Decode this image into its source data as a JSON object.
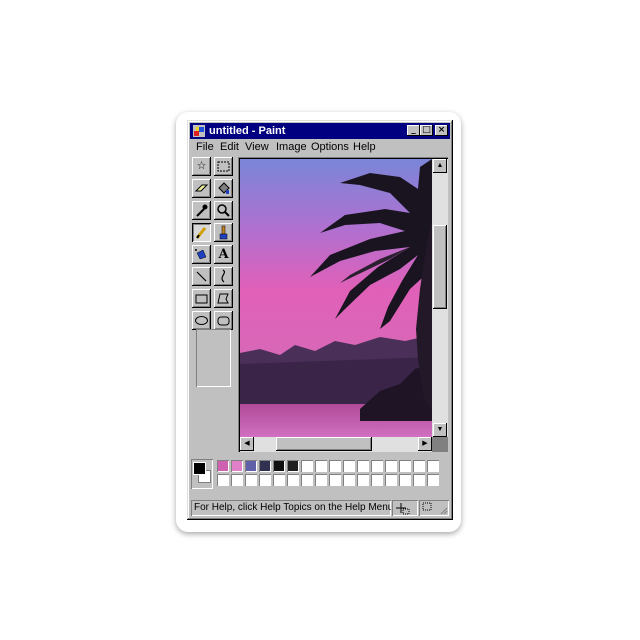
{
  "window": {
    "title": "untitled - Paint"
  },
  "title_buttons": {
    "minimize": "_",
    "maximize": "□",
    "close": "×"
  },
  "menu": [
    {
      "label": "File"
    },
    {
      "label": "Edit"
    },
    {
      "label": "View"
    },
    {
      "label": "Image"
    },
    {
      "label": "Options"
    },
    {
      "label": "Help"
    }
  ],
  "tools": [
    {
      "name": "free-form-select-icon",
      "glyph": "☆"
    },
    {
      "name": "select-icon",
      "glyph": "⬚"
    },
    {
      "name": "eraser-icon",
      "glyph": "▱"
    },
    {
      "name": "fill-bucket-icon",
      "glyph": "◈"
    },
    {
      "name": "pick-color-icon",
      "glyph": "⚲"
    },
    {
      "name": "magnifier-icon",
      "glyph": "🔍"
    },
    {
      "name": "pencil-icon",
      "glyph": "✎"
    },
    {
      "name": "brush-icon",
      "glyph": "♜"
    },
    {
      "name": "airbrush-icon",
      "glyph": "⚗"
    },
    {
      "name": "text-icon",
      "glyph": "A"
    },
    {
      "name": "line-icon",
      "glyph": "╲"
    },
    {
      "name": "curve-icon",
      "glyph": "∫"
    },
    {
      "name": "rectangle-icon",
      "glyph": "▭"
    },
    {
      "name": "polygon-icon",
      "glyph": "⬠"
    },
    {
      "name": "ellipse-icon",
      "glyph": "⬭"
    },
    {
      "name": "rounded-rectangle-icon",
      "glyph": "▢"
    }
  ],
  "selected_tool": "pencil-icon",
  "palette": {
    "foreground": "#000000",
    "background": "#ffffff",
    "row1": [
      "#d060b0",
      "#e080c8",
      "#6060a8",
      "#303050",
      "#101010",
      "#202020",
      "#ffffff",
      "#ffffff",
      "#ffffff",
      "#ffffff",
      "#ffffff",
      "#ffffff",
      "#ffffff",
      "#ffffff",
      "#ffffff",
      "#ffffff"
    ],
    "row2": [
      "#ffffff",
      "#ffffff",
      "#ffffff",
      "#ffffff",
      "#ffffff",
      "#ffffff",
      "#ffffff",
      "#ffffff",
      "#ffffff",
      "#ffffff",
      "#ffffff",
      "#ffffff",
      "#ffffff",
      "#ffffff",
      "#ffffff",
      "#ffffff"
    ]
  },
  "status": {
    "text": "For Help, click Help Topics on the Help Menu."
  },
  "colors": {
    "title_bar": "#000080",
    "window_face": "#c0c0c0",
    "sky_top": "#7a86d8",
    "sky_bottom": "#e060b8",
    "water": "#b04a98",
    "hills": "#3a2448"
  }
}
